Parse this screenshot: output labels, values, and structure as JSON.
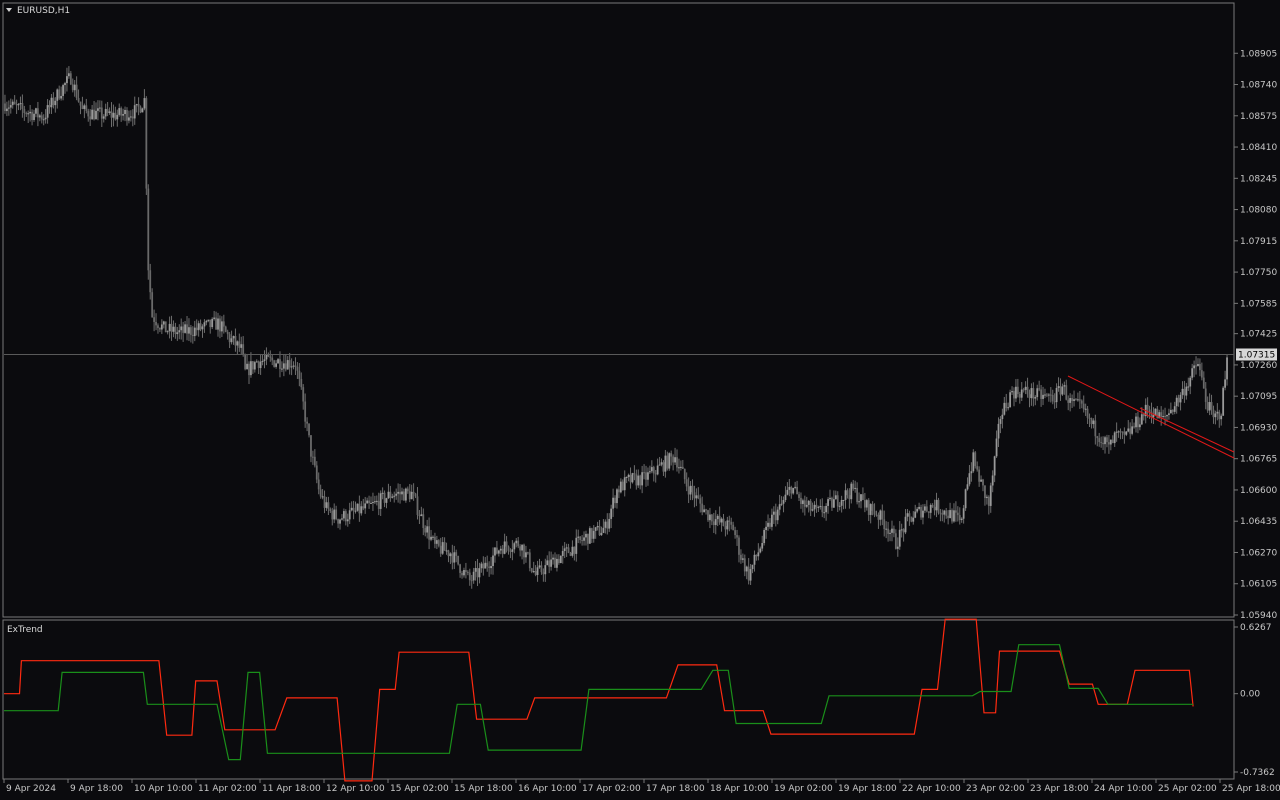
{
  "chart_data": [
    {
      "type": "candlestick",
      "title": "EURUSD,H1",
      "ylim": [
        1.0594,
        1.0907
      ],
      "y_ticks": [
        "1.08905",
        "1.08740",
        "1.08575",
        "1.08410",
        "1.08245",
        "1.08080",
        "1.07915",
        "1.07750",
        "1.07585",
        "1.07425",
        "1.07260",
        "1.07095",
        "1.06930",
        "1.06765",
        "1.06600",
        "1.06435",
        "1.06270",
        "1.06105",
        "1.05940"
      ],
      "current_price": "1.07315",
      "x_ticks": [
        "9 Apr 2024",
        "9 Apr 18:00",
        "10 Apr 10:00",
        "11 Apr 02:00",
        "11 Apr 18:00",
        "12 Apr 10:00",
        "15 Apr 02:00",
        "15 Apr 18:00",
        "16 Apr 10:00",
        "17 Apr 02:00",
        "17 Apr 18:00",
        "18 Apr 10:00",
        "19 Apr 02:00",
        "19 Apr 18:00",
        "22 Apr 10:00",
        "23 Apr 02:00",
        "23 Apr 18:00",
        "24 Apr 10:00",
        "25 Apr 02:00",
        "25 Apr 18:00"
      ],
      "close_path": [
        [
          0,
          1.0864
        ],
        [
          10,
          1.086
        ],
        [
          20,
          1.0857
        ],
        [
          28,
          1.087
        ],
        [
          34,
          1.0878
        ],
        [
          40,
          1.086
        ],
        [
          50,
          1.0858
        ],
        [
          60,
          1.0858
        ],
        [
          68,
          1.086
        ],
        [
          72,
          1.0866
        ],
        [
          74,
          1.0778
        ],
        [
          76,
          1.0752
        ],
        [
          82,
          1.0745
        ],
        [
          90,
          1.0743
        ],
        [
          100,
          1.0745
        ],
        [
          110,
          1.0748
        ],
        [
          116,
          1.074
        ],
        [
          122,
          1.0734
        ],
        [
          124,
          1.0722
        ],
        [
          130,
          1.0728
        ],
        [
          140,
          1.0728
        ],
        [
          150,
          1.0727
        ],
        [
          154,
          1.0705
        ],
        [
          158,
          1.068
        ],
        [
          162,
          1.066
        ],
        [
          166,
          1.065
        ],
        [
          172,
          1.0645
        ],
        [
          180,
          1.0648
        ],
        [
          190,
          1.0652
        ],
        [
          200,
          1.0658
        ],
        [
          210,
          1.0658
        ],
        [
          216,
          1.0643
        ],
        [
          222,
          1.063
        ],
        [
          230,
          1.0627
        ],
        [
          240,
          1.0612
        ],
        [
          248,
          1.062
        ],
        [
          256,
          1.063
        ],
        [
          266,
          1.0632
        ],
        [
          274,
          1.0615
        ],
        [
          280,
          1.062
        ],
        [
          290,
          1.0627
        ],
        [
          300,
          1.0635
        ],
        [
          310,
          1.064
        ],
        [
          316,
          1.066
        ],
        [
          322,
          1.0665
        ],
        [
          330,
          1.0666
        ],
        [
          338,
          1.0672
        ],
        [
          346,
          1.0678
        ],
        [
          352,
          1.0663
        ],
        [
          358,
          1.0654
        ],
        [
          362,
          1.0648
        ],
        [
          370,
          1.0642
        ],
        [
          376,
          1.064
        ],
        [
          380,
          1.0625
        ],
        [
          384,
          1.0615
        ],
        [
          390,
          1.063
        ],
        [
          396,
          1.0645
        ],
        [
          400,
          1.065
        ],
        [
          406,
          1.0662
        ],
        [
          412,
          1.0652
        ],
        [
          420,
          1.0648
        ],
        [
          430,
          1.0655
        ],
        [
          438,
          1.066
        ],
        [
          444,
          1.0652
        ],
        [
          450,
          1.0648
        ],
        [
          456,
          1.064
        ],
        [
          460,
          1.0632
        ],
        [
          466,
          1.0644
        ],
        [
          474,
          1.065
        ],
        [
          480,
          1.0652
        ],
        [
          486,
          1.0648
        ],
        [
          490,
          1.0646
        ],
        [
          494,
          1.0642
        ],
        [
          496,
          1.0662
        ],
        [
          500,
          1.0676
        ],
        [
          504,
          1.0663
        ],
        [
          508,
          1.0652
        ],
        [
          514,
          1.0699
        ],
        [
          520,
          1.0712
        ],
        [
          526,
          1.0712
        ],
        [
          532,
          1.071
        ],
        [
          538,
          1.0709
        ],
        [
          542,
          1.0709
        ],
        [
          546,
          1.0715
        ],
        [
          550,
          1.0706
        ],
        [
          556,
          1.0703
        ],
        [
          562,
          1.0693
        ],
        [
          566,
          1.0688
        ],
        [
          570,
          1.0682
        ],
        [
          574,
          1.0689
        ],
        [
          578,
          1.0687
        ],
        [
          584,
          1.0695
        ],
        [
          590,
          1.0703
        ],
        [
          598,
          1.0697
        ],
        [
          606,
          1.0708
        ],
        [
          612,
          1.0719
        ],
        [
          616,
          1.0727
        ],
        [
          620,
          1.0708
        ],
        [
          624,
          1.0697
        ],
        [
          628,
          1.0702
        ],
        [
          631,
          1.0728
        ]
      ]
    },
    {
      "type": "line",
      "title": "ExTrend",
      "ylim": [
        -0.7362,
        0.6267
      ],
      "y_ticks": [
        "0.6267",
        "0.00",
        "-0.7362"
      ],
      "series": [
        {
          "color": "#ff2a10",
          "points": [
            [
              0,
              0.0
            ],
            [
              8,
              0.0
            ],
            [
              9,
              0.31
            ],
            [
              80,
              0.31
            ],
            [
              84,
              -0.39
            ],
            [
              97,
              -0.39
            ],
            [
              99,
              0.12
            ],
            [
              110,
              0.12
            ],
            [
              114,
              -0.34
            ],
            [
              140,
              -0.34
            ],
            [
              146,
              -0.04
            ],
            [
              172,
              -0.04
            ],
            [
              176,
              -0.82
            ],
            [
              190,
              -0.82
            ],
            [
              194,
              0.04
            ],
            [
              202,
              0.04
            ],
            [
              204,
              0.39
            ],
            [
              240,
              0.39
            ],
            [
              244,
              -0.24
            ],
            [
              270,
              -0.24
            ],
            [
              274,
              -0.04
            ],
            [
              342,
              -0.04
            ],
            [
              348,
              0.27
            ],
            [
              368,
              0.27
            ],
            [
              372,
              -0.16
            ],
            [
              392,
              -0.16
            ],
            [
              396,
              -0.38
            ],
            [
              470,
              -0.38
            ],
            [
              474,
              0.04
            ],
            [
              482,
              0.04
            ],
            [
              486,
              0.7
            ],
            [
              502,
              0.7
            ],
            [
              506,
              -0.18
            ],
            [
              512,
              -0.18
            ],
            [
              514,
              0.4
            ],
            [
              545,
              0.4
            ],
            [
              550,
              0.09
            ],
            [
              562,
              0.09
            ],
            [
              565,
              -0.1
            ],
            [
              580,
              -0.1
            ],
            [
              584,
              0.22
            ],
            [
              612,
              0.22
            ],
            [
              614,
              -0.12
            ]
          ]
        },
        {
          "color": "#1a8f1a",
          "points": [
            [
              0,
              -0.16
            ],
            [
              28,
              -0.16
            ],
            [
              30,
              0.2
            ],
            [
              72,
              0.2
            ],
            [
              74,
              -0.1
            ],
            [
              110,
              -0.1
            ],
            [
              116,
              -0.62
            ],
            [
              122,
              -0.62
            ],
            [
              126,
              0.2
            ],
            [
              132,
              0.2
            ],
            [
              136,
              -0.56
            ],
            [
              230,
              -0.56
            ],
            [
              234,
              -0.1
            ],
            [
              246,
              -0.1
            ],
            [
              250,
              -0.53
            ],
            [
              298,
              -0.53
            ],
            [
              302,
              0.04
            ],
            [
              360,
              0.04
            ],
            [
              366,
              0.22
            ],
            [
              374,
              0.22
            ],
            [
              378,
              -0.28
            ],
            [
              422,
              -0.28
            ],
            [
              426,
              -0.02
            ],
            [
              500,
              -0.02
            ],
            [
              504,
              0.02
            ],
            [
              520,
              0.02
            ],
            [
              524,
              0.46
            ],
            [
              545,
              0.46
            ],
            [
              550,
              0.05
            ],
            [
              565,
              0.05
            ],
            [
              570,
              -0.1
            ],
            [
              614,
              -0.1
            ]
          ]
        }
      ]
    }
  ]
}
